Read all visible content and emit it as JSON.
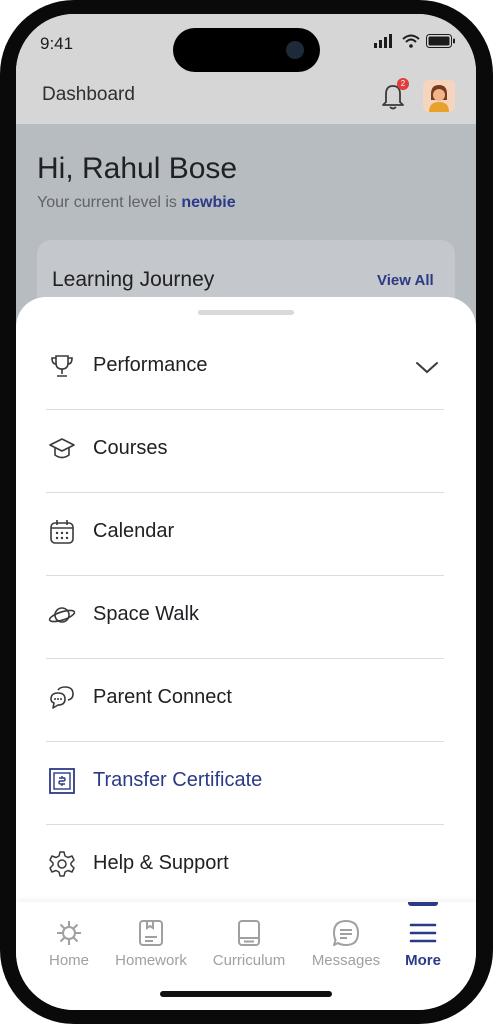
{
  "status": {
    "time": "9:41"
  },
  "header": {
    "title": "Dashboard",
    "notification_count": "2"
  },
  "greeting": {
    "name_line": "Hi, Rahul Bose",
    "level_prefix": "Your current level is ",
    "level_value": "newbie"
  },
  "journey": {
    "title": "Learning Journey",
    "view_all": "View All"
  },
  "menu": {
    "items": [
      {
        "label": "Performance",
        "icon": "trophy-icon"
      },
      {
        "label": "Courses",
        "icon": "graduation-cap-icon"
      },
      {
        "label": "Calendar",
        "icon": "calendar-icon"
      },
      {
        "label": "Space Walk",
        "icon": "planet-icon"
      },
      {
        "label": "Parent Connect",
        "icon": "chat-bubbles-icon"
      },
      {
        "label": "Transfer Certificate",
        "icon": "certificate-icon"
      },
      {
        "label": "Help & Support",
        "icon": "gear-icon"
      }
    ],
    "active_index": 5
  },
  "tabs": [
    {
      "label": "Home",
      "icon": "home-icon"
    },
    {
      "label": "Homework",
      "icon": "homework-icon"
    },
    {
      "label": "Curriculum",
      "icon": "book-icon"
    },
    {
      "label": "Messages",
      "icon": "message-icon"
    },
    {
      "label": "More",
      "icon": "menu-icon"
    }
  ],
  "colors": {
    "accent": "#2c3a86",
    "inactive": "#a0a0a0",
    "badge": "#e33c3c"
  }
}
